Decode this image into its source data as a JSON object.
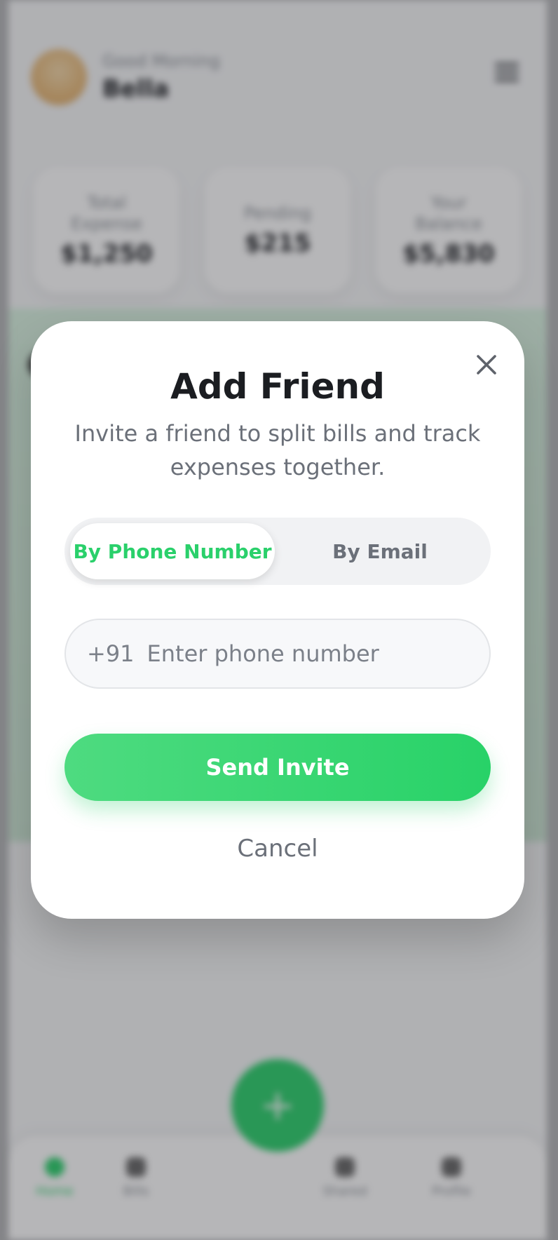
{
  "background": {
    "greeting": "Good Morning",
    "user_name": "Bella",
    "stats": [
      {
        "label": "Total Expense",
        "value": "$1,250"
      },
      {
        "label": "Pending",
        "value": "$215"
      },
      {
        "label": "Your Balance",
        "value": "$5,830"
      }
    ],
    "nav": [
      {
        "label": "Home"
      },
      {
        "label": "Bills"
      },
      {
        "label": "Shared"
      },
      {
        "label": "Profile"
      }
    ],
    "fab_symbol": "+"
  },
  "modal": {
    "title": "Add Friend",
    "subtitle": "Invite a friend to split bills and track expenses together.",
    "tabs": [
      {
        "label": "By Phone Number",
        "active": true
      },
      {
        "label": "By Email",
        "active": false
      }
    ],
    "phone": {
      "country_code": "+91",
      "value": "",
      "placeholder": "Enter phone number"
    },
    "send_label": "Send Invite",
    "cancel_label": "Cancel",
    "close_icon": "close-icon"
  },
  "colors": {
    "accent": "#2ad06b",
    "title": "#1b1d21",
    "muted": "#6b7079"
  }
}
